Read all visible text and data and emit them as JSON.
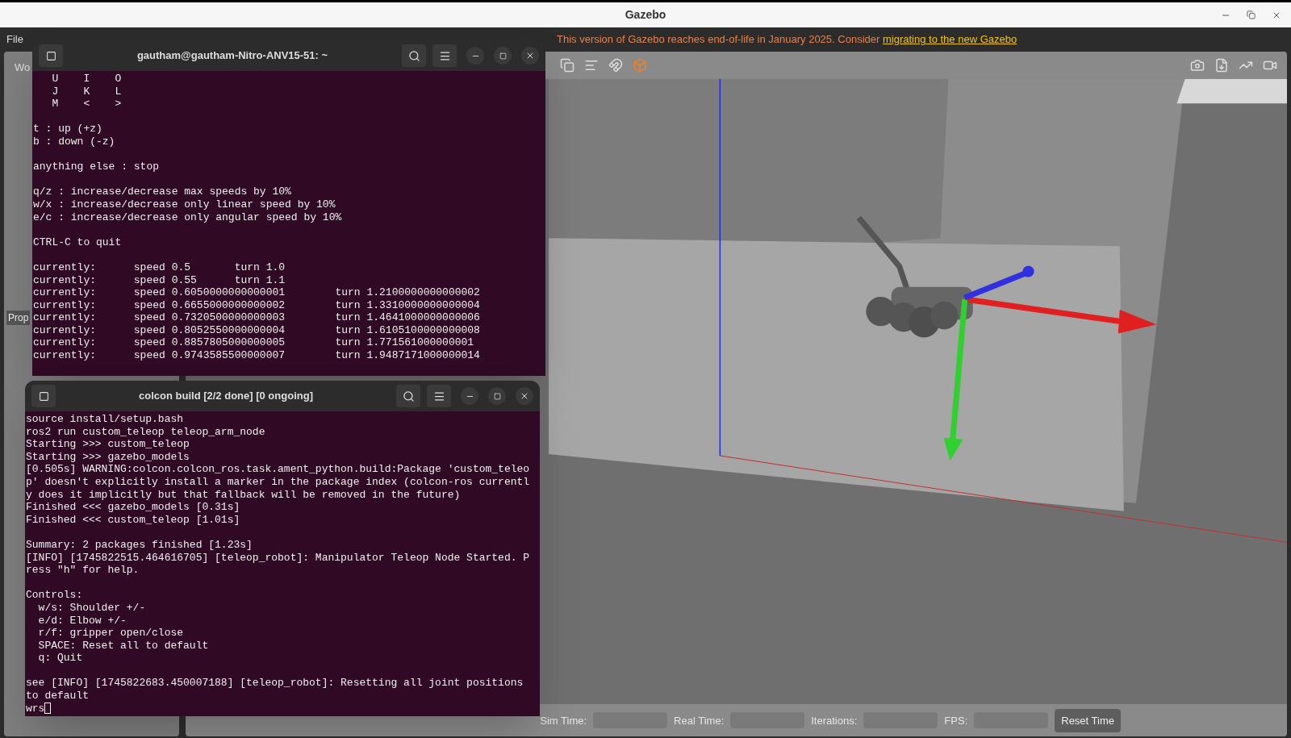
{
  "window": {
    "title": "Gazebo"
  },
  "menu": [
    "File"
  ],
  "banner": {
    "text": "This version of Gazebo reaches end-of-life in January 2025. Consider ",
    "link": "migrating to the new Gazebo"
  },
  "side_panel": {
    "tab": "Wo",
    "bottom_tab": "Prop"
  },
  "bottom_bar": {
    "fields": [
      "Sim Time:",
      "Real Time:",
      "Iterations:",
      "FPS:"
    ],
    "button": "Reset Time"
  },
  "terminals": [
    {
      "title": "gautham@gautham-Nitro-ANV15-51: ~",
      "blocks": [
        [
          "   U    I    O",
          "   J    K    L",
          "   M    <    >"
        ],
        [
          "t : up (+z)",
          "b : down (-z)"
        ],
        [
          "anything else : stop"
        ],
        [
          "q/z : increase/decrease max speeds by 10%",
          "w/x : increase/decrease only linear speed by 10%",
          "e/c : increase/decrease only angular speed by 10%"
        ],
        [
          "CTRL-C to quit"
        ],
        [
          "currently:      speed 0.5       turn 1.0",
          "currently:      speed 0.55      turn 1.1",
          "currently:      speed 0.6050000000000001        turn 1.2100000000000002",
          "currently:      speed 0.6655000000000002        turn 1.3310000000000004",
          "currently:      speed 0.7320500000000003        turn 1.4641000000000006",
          "currently:      speed 0.8052550000000004        turn 1.6105100000000008",
          "currently:      speed 0.8857805000000005        turn 1.771561000000001",
          "currently:      speed 0.9743585500000007        turn 1.9487171000000014"
        ]
      ]
    },
    {
      "title": "colcon build [2/2 done] [0 ongoing]",
      "blocks": [
        [
          "source install/setup.bash",
          "ros2 run custom_teleop teleop_arm_node",
          "Starting >>> custom_teleop",
          "Starting >>> gazebo_models",
          "[0.505s] WARNING:colcon.colcon_ros.task.ament_python.build:Package 'custom_teleo",
          "p' doesn't explicitly install a marker in the package index (colcon-ros currentl",
          "y does it implicitly but that fallback will be removed in the future)",
          "Finished <<< gazebo_models [0.31s]",
          "Finished <<< custom_teleop [1.01s]"
        ],
        [
          "Summary: 2 packages finished [1.23s]",
          "[INFO] [1745822515.464616705] [teleop_robot]: Manipulator Teleop Node Started. P",
          "ress \"h\" for help."
        ],
        [
          "Controls:",
          "  w/s: Shoulder +/-",
          "  e/d: Elbow +/-",
          "  r/f: gripper open/close",
          "  SPACE: Reset all to default",
          "  q: Quit"
        ],
        [
          "see [INFO] [1745822683.450007188] [teleop_robot]: Resetting all joint positions",
          "to default",
          "wrs"
        ]
      ]
    }
  ]
}
